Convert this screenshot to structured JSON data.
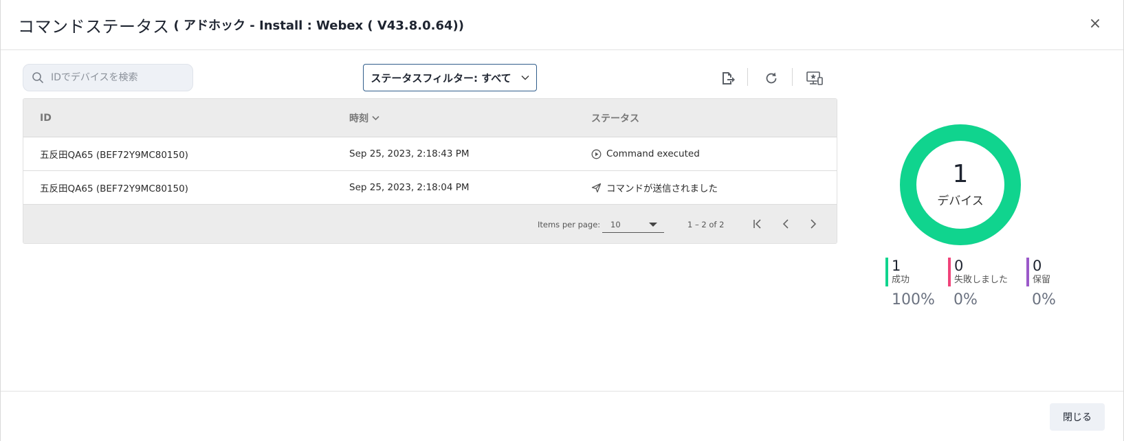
{
  "dialog": {
    "title": "コマンドステータス",
    "subtitle": "( アドホック - Install : Webex ( V43.8.0.64))",
    "close_icon_glyph": "×"
  },
  "toolbar": {
    "search_placeholder": "IDでデバイスを検索",
    "search_value": "",
    "filter_label": "ステータスフィルター: すべて",
    "export_icon": "export-icon",
    "refresh_icon": "refresh-icon",
    "device_icon": "device-star-icon"
  },
  "table": {
    "columns": {
      "id": "ID",
      "time": "時刻",
      "status": "ステータス"
    },
    "rows": [
      {
        "id": "五反田QA65 (BEF72Y9MC80150)",
        "time": "Sep 25, 2023, 2:18:43 PM",
        "status": "Command executed",
        "status_icon": "play-circle-icon"
      },
      {
        "id": "五反田QA65 (BEF72Y9MC80150)",
        "time": "Sep 25, 2023, 2:18:04 PM",
        "status": "コマンドが送信されました",
        "status_icon": "send-icon"
      }
    ],
    "pagination": {
      "items_per_page_label": "Items per page:",
      "items_per_page_value": "10",
      "range_label": "1 – 2 of 2"
    }
  },
  "summary": {
    "total_count": "1",
    "total_label": "デバイス",
    "success_fraction": 1.0,
    "stats": [
      {
        "count": "1",
        "label": "成功",
        "percent": "100%",
        "color": "#10d48e"
      },
      {
        "count": "0",
        "label": "失敗しました",
        "percent": "0%",
        "color": "#f0447a"
      },
      {
        "count": "0",
        "label": "保留",
        "percent": "0%",
        "color": "#9b59c9"
      }
    ]
  },
  "footer": {
    "close_label": "閉じる"
  },
  "colors": {
    "accent": "#10d48e",
    "filter_border": "#2f5c8a"
  }
}
